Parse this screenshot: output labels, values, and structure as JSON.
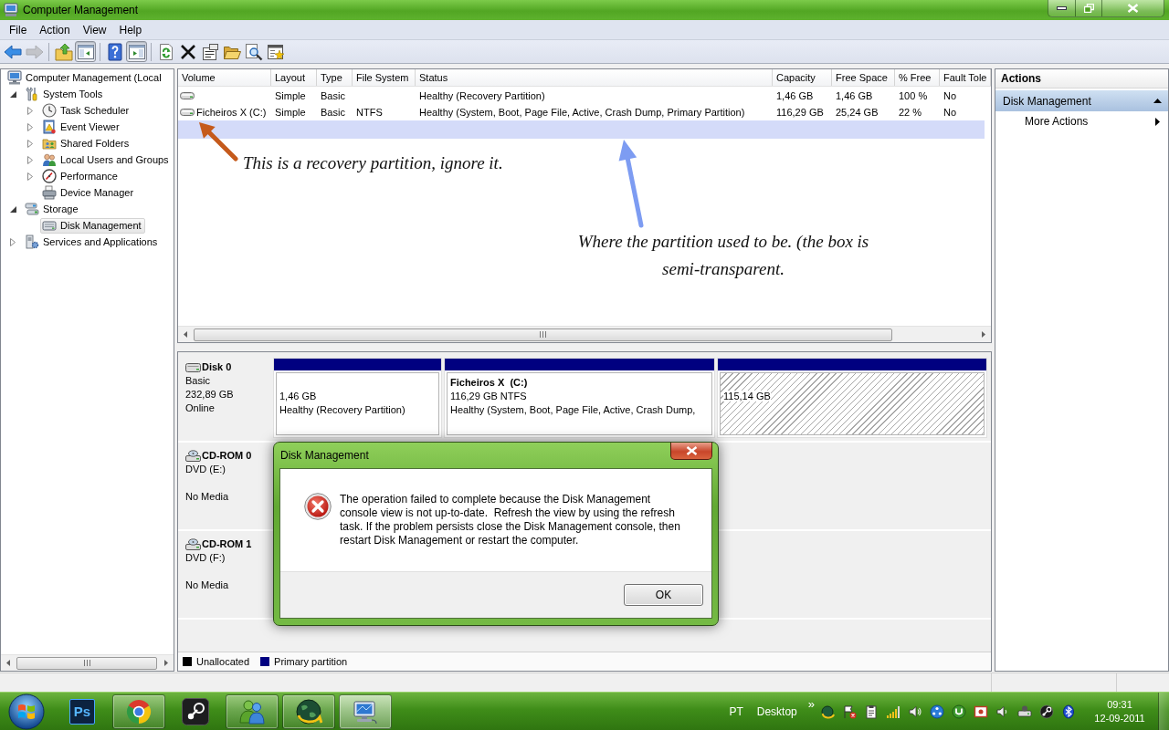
{
  "window": {
    "title": "Computer Management"
  },
  "menu": [
    {
      "label": "File"
    },
    {
      "label": "Action"
    },
    {
      "label": "View"
    },
    {
      "label": "Help"
    }
  ],
  "toolbar_groups": [
    {
      "buttons": [
        {
          "kind": "back",
          "disabled": false,
          "pressed": false
        },
        {
          "kind": "forward",
          "disabled": true,
          "pressed": false
        }
      ]
    },
    {
      "buttons": [
        {
          "kind": "up",
          "disabled": false,
          "pressed": false
        },
        {
          "kind": "console-tree",
          "disabled": false,
          "pressed": true
        }
      ]
    },
    {
      "buttons": [
        {
          "kind": "help",
          "disabled": false,
          "pressed": false
        },
        {
          "kind": "action-pane",
          "disabled": false,
          "pressed": true
        }
      ]
    },
    {
      "buttons": [
        {
          "kind": "refresh",
          "disabled": false,
          "pressed": false
        },
        {
          "kind": "delete",
          "disabled": false,
          "pressed": false
        },
        {
          "kind": "properties",
          "disabled": false,
          "pressed": false
        },
        {
          "kind": "open",
          "disabled": false,
          "pressed": false
        },
        {
          "kind": "search",
          "disabled": false,
          "pressed": false
        },
        {
          "kind": "settings",
          "disabled": false,
          "pressed": false
        }
      ]
    }
  ],
  "tree": [
    {
      "label": "Computer Management (Local",
      "kind": "computer",
      "selected": false,
      "children": [
        {
          "label": "System Tools",
          "kind": "tools",
          "expanded": true,
          "selected": false,
          "children": [
            {
              "label": "Task Scheduler",
              "kind": "scheduler",
              "expanded": false,
              "selected": false
            },
            {
              "label": "Event Viewer",
              "kind": "events",
              "expanded": false,
              "selected": false
            },
            {
              "label": "Shared Folders",
              "kind": "shared-folders",
              "expanded": false,
              "selected": false
            },
            {
              "label": "Local Users and Groups",
              "kind": "users",
              "expanded": false,
              "selected": false
            },
            {
              "label": "Performance",
              "kind": "performance",
              "expanded": false,
              "selected": false
            },
            {
              "label": "Device Manager",
              "kind": "device-manager",
              "selected": false
            }
          ]
        },
        {
          "label": "Storage",
          "kind": "storage",
          "expanded": true,
          "selected": false,
          "children": [
            {
              "label": "Disk Management",
              "kind": "disk-management",
              "selected": true
            }
          ]
        },
        {
          "label": "Services and Applications",
          "kind": "services",
          "expanded": false,
          "selected": false
        }
      ]
    }
  ],
  "volumes": {
    "columns": [
      {
        "label": "Volume"
      },
      {
        "label": "Layout"
      },
      {
        "label": "Type"
      },
      {
        "label": "File System"
      },
      {
        "label": "Status"
      },
      {
        "label": "Capacity"
      },
      {
        "label": "Free Space"
      },
      {
        "label": "% Free"
      },
      {
        "label": "Fault Tole"
      }
    ],
    "rows": [
      {
        "kind": "volume",
        "selected": false,
        "layout": "Simple",
        "type": "Basic",
        "status": "Healthy (Recovery Partition)",
        "capacity": "1,46 GB",
        "free_space": "1,46 GB",
        "percent_free": "100 %",
        "column_9": "No"
      },
      {
        "kind": "volume",
        "selected": false,
        "volume": "Ficheiros X (C:)",
        "layout": "Simple",
        "type": "Basic",
        "file_system": "NTFS",
        "status": "Healthy (System, Boot, Page File, Active, Crash Dump, Primary Partition)",
        "capacity": "116,29 GB",
        "free_space": "25,24 GB",
        "percent_free": "22 %",
        "column_9": "No"
      },
      {
        "kind": "empty",
        "selected": true
      }
    ]
  },
  "disks": [
    {
      "kind": "disk",
      "name": "Disk 0",
      "type": "Basic",
      "size": "232,89 GB",
      "status": "Online",
      "partitions": [
        {
          "kind": "primary",
          "size": "1,46 GB",
          "status": "Healthy (Recovery Partition)"
        },
        {
          "kind": "primary",
          "name": "Ficheiros X  (C:)",
          "size": "116,29 GB NTFS",
          "status": "Healthy (System, Boot, Page File, Active, Crash Dump,"
        },
        {
          "kind": "unallocated",
          "size": "115,14 GB"
        }
      ]
    },
    {
      "kind": "cdrom",
      "name": "CD-ROM 0",
      "type": "DVD (E:)",
      "status": "No Media"
    },
    {
      "kind": "cdrom",
      "name": "CD-ROM 1",
      "type": "DVD (F:)",
      "status": "No Media"
    }
  ],
  "legend": [
    {
      "label": "Unallocated",
      "color": "#000000"
    },
    {
      "label": "Primary partition",
      "color": "#000080"
    }
  ],
  "actions": {
    "title": "Actions",
    "sections": [
      {
        "label": "Disk Management",
        "expanded": true,
        "items": [
          {
            "label": "More Actions"
          }
        ]
      }
    ]
  },
  "annotations": [
    {
      "text": "This is a recovery partition, ignore it.",
      "color": "#c55a1c"
    },
    {
      "text": "Where the partition used to be. (the box is semi-transparent.",
      "color": "#7d9cf2"
    }
  ],
  "dialog": {
    "title": "Disk Management",
    "kind": "error",
    "message": "The operation failed to complete because the Disk Management console view is not up-to-date.  Refresh the view by using the refresh task. If the problem persists close the Disk Management console, then restart Disk Management or restart the computer.",
    "buttons": [
      {
        "label": "OK"
      }
    ]
  },
  "taskbar": {
    "apps": [
      {
        "kind": "ps",
        "label": "Ps",
        "running": false,
        "active": false
      },
      {
        "kind": "browser",
        "running": true,
        "active": false
      },
      {
        "kind": "steam",
        "running": false,
        "active": false
      },
      {
        "kind": "messenger",
        "running": true,
        "active": false
      },
      {
        "kind": "globe",
        "running": true,
        "active": false
      },
      {
        "kind": "network",
        "running": true,
        "active": true
      }
    ],
    "language": "PT",
    "toolbar": "Desktop",
    "chevron": "»",
    "time": "09:31",
    "date": "12-09-2011"
  }
}
